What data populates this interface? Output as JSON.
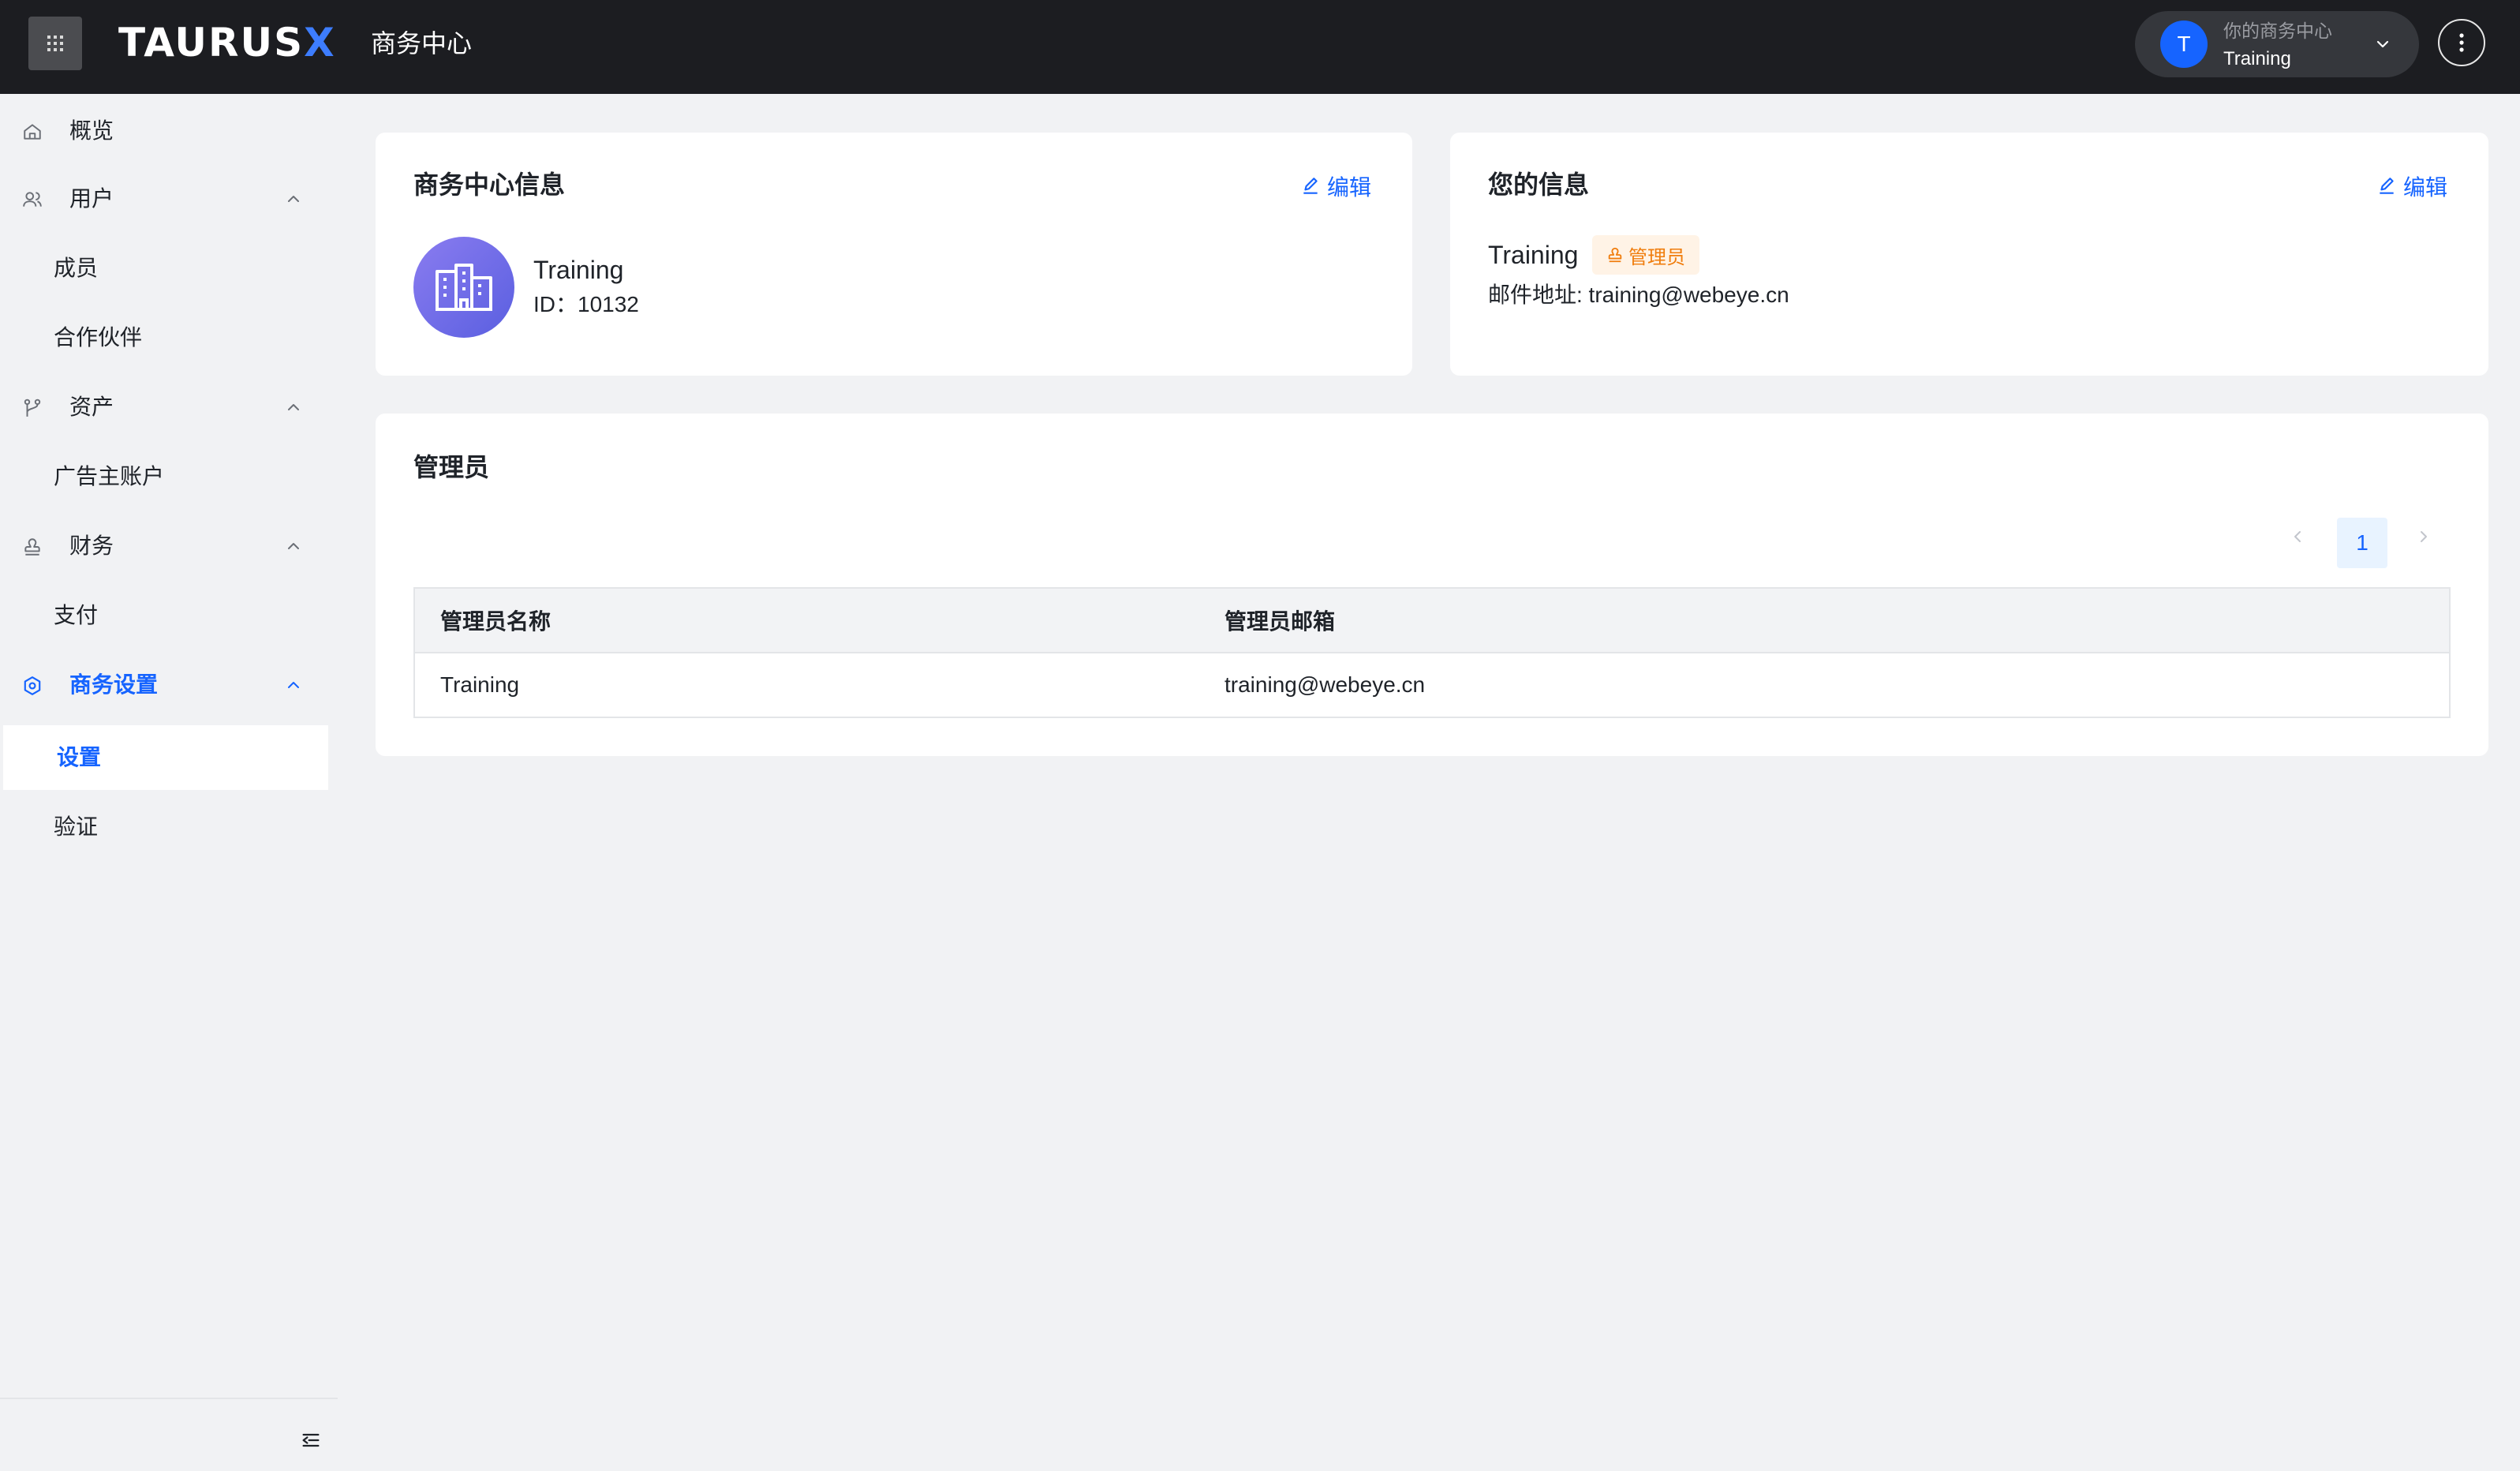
{
  "header": {
    "logo_main": "TAURUS",
    "logo_x": "X",
    "logo_sub": "商务中心",
    "account": {
      "avatar_letter": "T",
      "caption": "你的商务中心",
      "name": "Training"
    }
  },
  "sidebar": {
    "overview": "概览",
    "users": "用户",
    "members": "成员",
    "partners": "合作伙伴",
    "assets": "资产",
    "ad_accounts": "广告主账户",
    "finance": "财务",
    "payment": "支付",
    "business_settings": "商务设置",
    "settings": "设置",
    "verification": "验证"
  },
  "bc_info": {
    "title": "商务中心信息",
    "edit_label": "编辑",
    "name": "Training",
    "id_text": "ID：10132"
  },
  "your_info": {
    "title": "您的信息",
    "edit_label": "编辑",
    "name": "Training",
    "role": "管理员",
    "email_text": "邮件地址: training@webeye.cn"
  },
  "admins": {
    "title": "管理员",
    "pagination": {
      "current": "1"
    },
    "columns": [
      "管理员名称",
      "管理员邮箱"
    ],
    "rows": [
      {
        "name": "Training",
        "email": "training@webeye.cn"
      }
    ]
  },
  "colors": {
    "accent": "#1664ff",
    "topbar": "#1c1d21",
    "badge_text": "#f07d0d",
    "badge_bg": "#fff3e6"
  }
}
